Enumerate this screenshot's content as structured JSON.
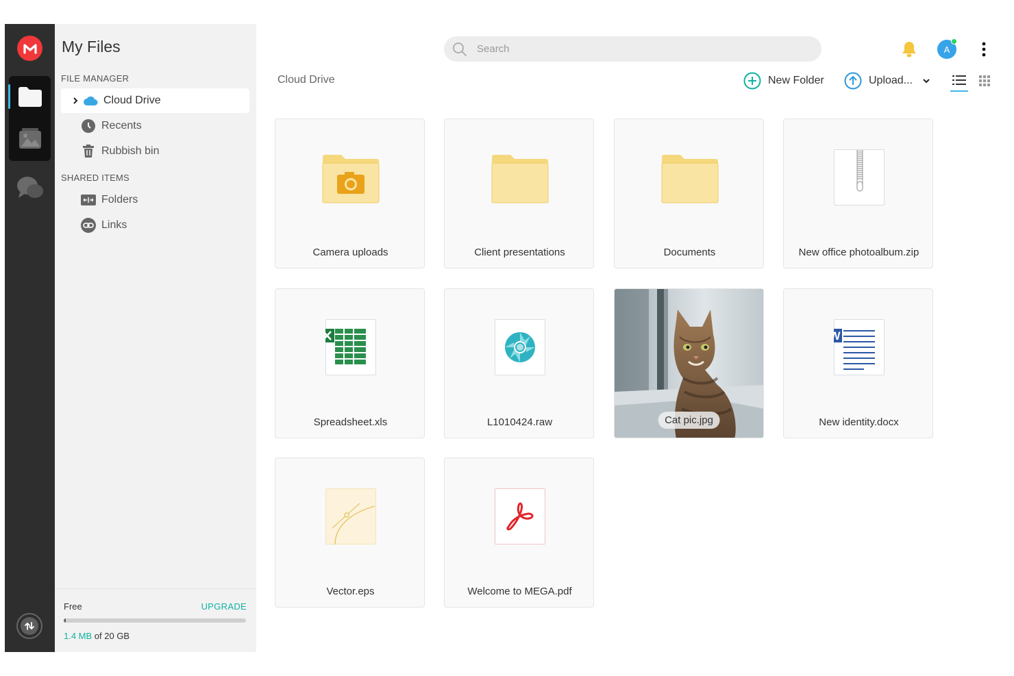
{
  "app": {
    "title": "My Files"
  },
  "sidebar": {
    "title": "My Files",
    "file_manager_label": "FILE MANAGER",
    "shared_items_label": "SHARED ITEMS",
    "items": [
      {
        "label": "Cloud Drive",
        "icon": "cloud-icon",
        "active": true
      },
      {
        "label": "Recents",
        "icon": "clock-icon"
      },
      {
        "label": "Rubbish bin",
        "icon": "trash-icon"
      }
    ],
    "shared": [
      {
        "label": "Folders",
        "icon": "shared-folder-icon"
      },
      {
        "label": "Links",
        "icon": "link-icon"
      }
    ],
    "footer": {
      "plan": "Free",
      "upgrade": "UPGRADE",
      "used": "1.4 MB",
      "of_total": " of 20 GB",
      "usage_fraction": 0.01
    }
  },
  "search": {
    "placeholder": "Search"
  },
  "toolbar": {
    "breadcrumb": "Cloud Drive",
    "new_folder": "New Folder",
    "upload": "Upload..."
  },
  "user": {
    "initial": "A"
  },
  "colors": {
    "accent": "#10b3a1",
    "brand_red": "#f0373a",
    "folder_yellow": "#f9e4a3",
    "folder_tab": "#f5d77d",
    "active_blue": "#3fb8e8"
  },
  "files": [
    {
      "name": "Camera uploads",
      "type": "camera-folder"
    },
    {
      "name": "Client presentations",
      "type": "folder"
    },
    {
      "name": "Documents",
      "type": "folder"
    },
    {
      "name": "New office photoalbum.zip",
      "type": "zip"
    },
    {
      "name": "Spreadsheet.xls",
      "type": "excel"
    },
    {
      "name": "L1010424.raw",
      "type": "raw"
    },
    {
      "name": "Cat pic.jpg",
      "type": "image"
    },
    {
      "name": "New identity.docx",
      "type": "word"
    },
    {
      "name": "Vector.eps",
      "type": "vector"
    },
    {
      "name": "Welcome to MEGA.pdf",
      "type": "pdf"
    }
  ]
}
